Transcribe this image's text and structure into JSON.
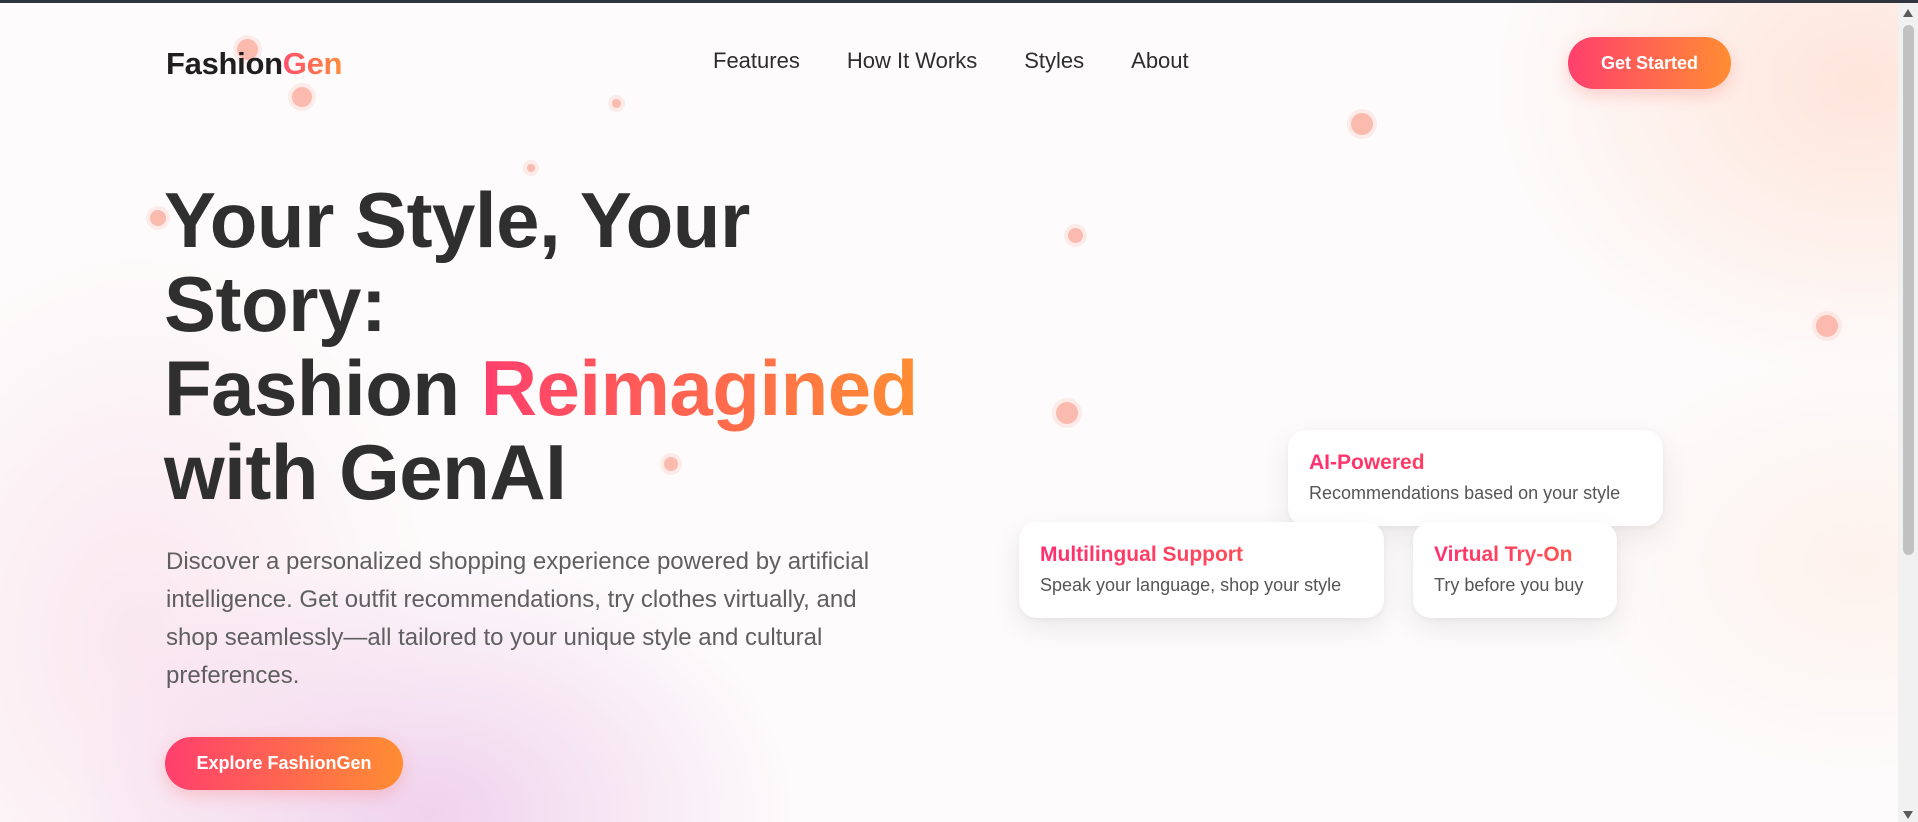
{
  "brand": {
    "name_part1": "Fashion",
    "name_part2": "Gen"
  },
  "nav": {
    "items": [
      "Features",
      "How It Works",
      "Styles",
      "About"
    ]
  },
  "header": {
    "cta_label": "Get Started"
  },
  "hero": {
    "title_line1": "Your Style, Your",
    "title_line2": "Story:",
    "title_line3_prefix": "Fashion ",
    "title_line3_highlight": "Reimagined",
    "title_line4": "with GenAI",
    "description": "Discover a personalized shopping experience powered by artificial intelligence. Get outfit recommendations, try clothes virtually, and shop seamlessly—all tailored to your unique style and cultural preferences.",
    "cta_label": "Explore FashionGen"
  },
  "feature_cards": [
    {
      "title": "AI-Powered",
      "description": "Recommendations based on your style"
    },
    {
      "title": "Multilingual Support",
      "description": "Speak your language, shop your style"
    },
    {
      "title": "Virtual Try-On",
      "description": "Try before you buy"
    }
  ],
  "colors": {
    "accent_start": "#ff3f6d",
    "accent_end": "#ff8d32",
    "text_dark": "#2f2f2f",
    "text_muted": "#5f5f5f"
  }
}
